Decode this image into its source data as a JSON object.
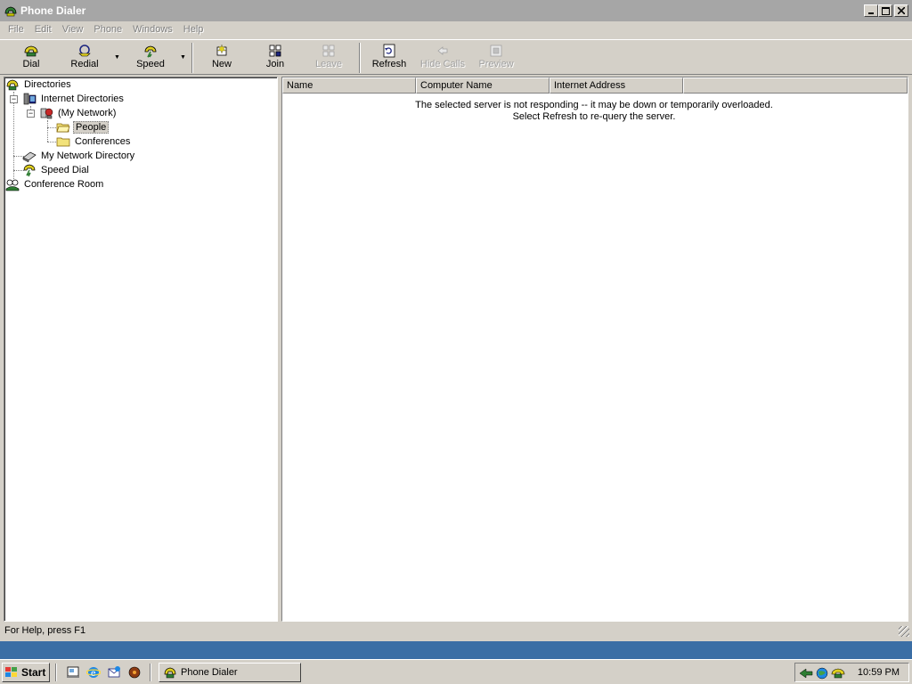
{
  "window": {
    "title": "Phone Dialer",
    "controls": {
      "minimize": "_",
      "maximize": "□",
      "close": "×"
    }
  },
  "menu": [
    "File",
    "Edit",
    "View",
    "Phone",
    "Windows",
    "Help"
  ],
  "toolbar": {
    "dial": "Dial",
    "redial": "Redial",
    "speed": "Speed",
    "new": "New",
    "join": "Join",
    "leave": "Leave",
    "refresh": "Refresh",
    "hide_calls": "Hide Calls",
    "preview": "Preview"
  },
  "tree": {
    "directories": "Directories",
    "internet_directories": "Internet Directories",
    "my_network": "(My Network)",
    "people": "People",
    "conferences": "Conferences",
    "my_network_directory": "My Network Directory",
    "speed_dial": "Speed Dial",
    "conference_room": "Conference Room"
  },
  "list": {
    "columns": [
      "Name",
      "Computer Name",
      "Internet Address"
    ],
    "message_line1": "The selected server is not responding -- it may be down or temporarily overloaded.",
    "message_line2": "Select Refresh to re-query the server."
  },
  "status": {
    "text": "For Help, press F1"
  },
  "taskbar": {
    "start": "Start",
    "task_button": "Phone Dialer",
    "clock": "10:59 PM"
  },
  "colors": {
    "face": "#d4d0c8",
    "inactive_title": "#a6a6a6",
    "desktop": "#3a6ea5"
  }
}
